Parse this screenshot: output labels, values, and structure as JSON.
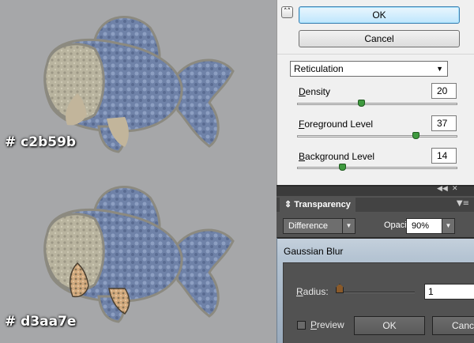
{
  "canvas": {
    "label_top": "# c2b59b",
    "label_bottom": "# d3aa7e",
    "colors": {
      "fin_top": "#c2b59b",
      "fin_bottom": "#d3aa7e",
      "scales": "#6f82a8",
      "belly": "#b9b49f"
    }
  },
  "filter_panel": {
    "collapse_icon": "double-chevron-up",
    "ok_label": "OK",
    "cancel_label": "Cancel",
    "filter_name": "Reticulation",
    "params": [
      {
        "prefix": "",
        "accel": "D",
        "rest": "ensity",
        "value": "20",
        "level": 0.4
      },
      {
        "prefix": "",
        "accel": "F",
        "rest": "oreground Level",
        "value": "37",
        "level": 0.74
      },
      {
        "prefix": "",
        "accel": "B",
        "rest": "ackground Level",
        "value": "14",
        "level": 0.28
      }
    ]
  },
  "transparency_panel": {
    "collapse_icon": "double-chevron-left",
    "close_icon": "close",
    "tab_label": "Transparency",
    "menu_icon": "panel-menu",
    "blend_mode": "Difference",
    "opacity_label": "Opacity:",
    "opacity_value": "90%"
  },
  "gaussian_blur": {
    "title": "Gaussian Blur",
    "radius_accel": "R",
    "radius_rest": "adius:",
    "radius_value": "1",
    "preview_accel": "P",
    "preview_rest": "review",
    "preview_checked": false,
    "ok_label": "OK",
    "cancel_label": "Cance"
  }
}
